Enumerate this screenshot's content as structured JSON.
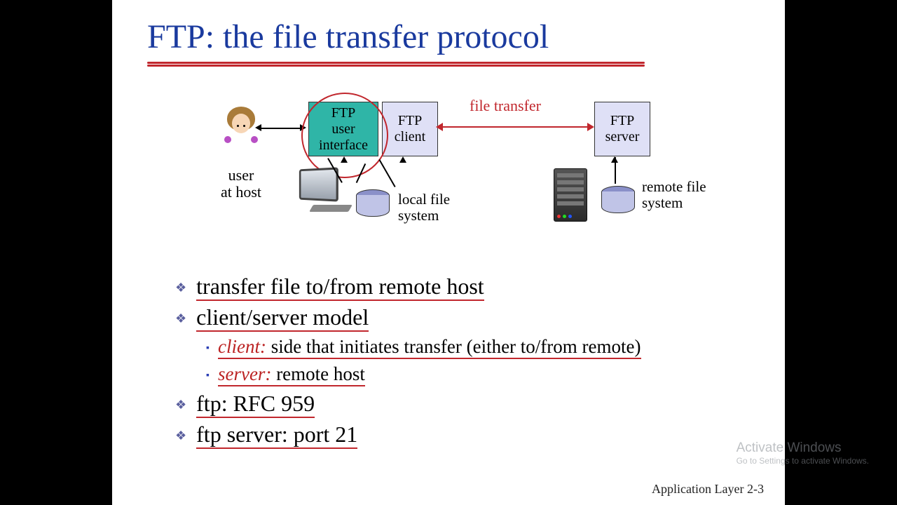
{
  "title": "FTP: the file transfer protocol",
  "diagram": {
    "user_label": "user\nat host",
    "box_ui": "FTP\nuser\ninterface",
    "box_client": "FTP\nclient",
    "box_server": "FTP\nserver",
    "file_transfer_label": "file transfer",
    "local_fs_label": "local file\nsystem",
    "remote_fs_label": "remote file\nsystem"
  },
  "bullets": {
    "b1": "transfer file to/from remote host",
    "b2": "client/server model",
    "b2a_key": "client:",
    "b2a_text": " side that initiates transfer (either to/from remote)",
    "b2b_key": "server:",
    "b2b_text": " remote host",
    "b3": "ftp: RFC 959",
    "b4": "ftp server: port 21"
  },
  "footer": "Application Layer 2-3",
  "watermark": {
    "title": "Activate Windows",
    "sub": "Go to Settings to activate Windows."
  }
}
